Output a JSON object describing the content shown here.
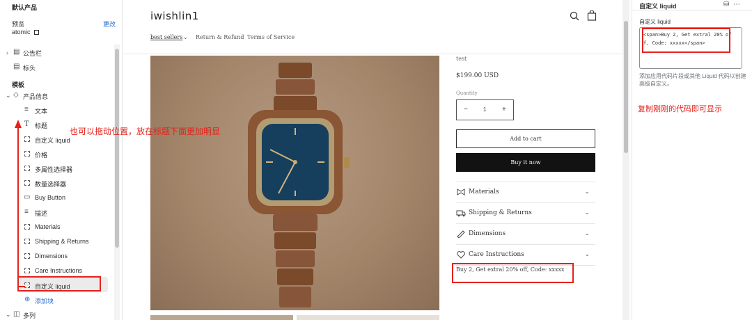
{
  "left_panel": {
    "header": "默认产品",
    "preview_label": "预览",
    "change_label": "更改",
    "preview_value": "atomic",
    "header_group": [
      {
        "label": "公告栏",
        "icon": "layout-icon"
      },
      {
        "label": "标头",
        "icon": "layout-icon"
      }
    ],
    "template_label": "模板",
    "section_label": "产品信息",
    "blocks": [
      {
        "label": "文本",
        "icon": "text-icon"
      },
      {
        "label": "标题",
        "icon": "title-icon"
      },
      {
        "label": "自定义 liquid",
        "icon": "custom-liquid-icon"
      },
      {
        "label": "价格",
        "icon": "custom-liquid-icon"
      },
      {
        "label": "多属性选择器",
        "icon": "custom-liquid-icon"
      },
      {
        "label": "数量选择器",
        "icon": "custom-liquid-icon"
      },
      {
        "label": "Buy Button",
        "icon": "buy-button-icon"
      },
      {
        "label": "描述",
        "icon": "text-icon"
      },
      {
        "label": "Materials",
        "icon": "custom-liquid-icon"
      },
      {
        "label": "Shipping & Returns",
        "icon": "custom-liquid-icon"
      },
      {
        "label": "Dimensions",
        "icon": "custom-liquid-icon"
      },
      {
        "label": "Care Instructions",
        "icon": "custom-liquid-icon"
      },
      {
        "label": "自定义 liquid",
        "icon": "custom-liquid-icon"
      }
    ],
    "add_block": "添加块",
    "next_section": "多列"
  },
  "annotation_drag": "也可以拖动位置，放在标题下面更加明显",
  "store": {
    "brand": "iwishlin1",
    "nav": [
      "best sellers",
      "Return & Refund",
      "Terms of Service"
    ],
    "product_title": "test",
    "price": "$199.00 USD",
    "quantity_label": "Quantity",
    "quantity_value": "1",
    "minus": "−",
    "plus": "+",
    "add_to_cart": "Add to cart",
    "buy_now": "Buy it now",
    "accordions": [
      "Materials",
      "Shipping & Returns",
      "Dimensions",
      "Care Instructions"
    ],
    "custom_text": "Buy 2, Get extral 20% off, Code: xxxxx"
  },
  "right_panel": {
    "title": "自定义 liquid",
    "field_label": "自定义 liquid",
    "code": "<span>Buy 2, Get extral 20% off, Code: xxxxx</span>",
    "help": "添加应用代码片段或其他 Liquid 代码以创建高级自定义。",
    "annotation": "复制刚刚的代码即可显示"
  },
  "colors": {
    "annotation_red": "#e5221a",
    "link_blue": "#2c6ecb",
    "button_dark": "#121212"
  }
}
